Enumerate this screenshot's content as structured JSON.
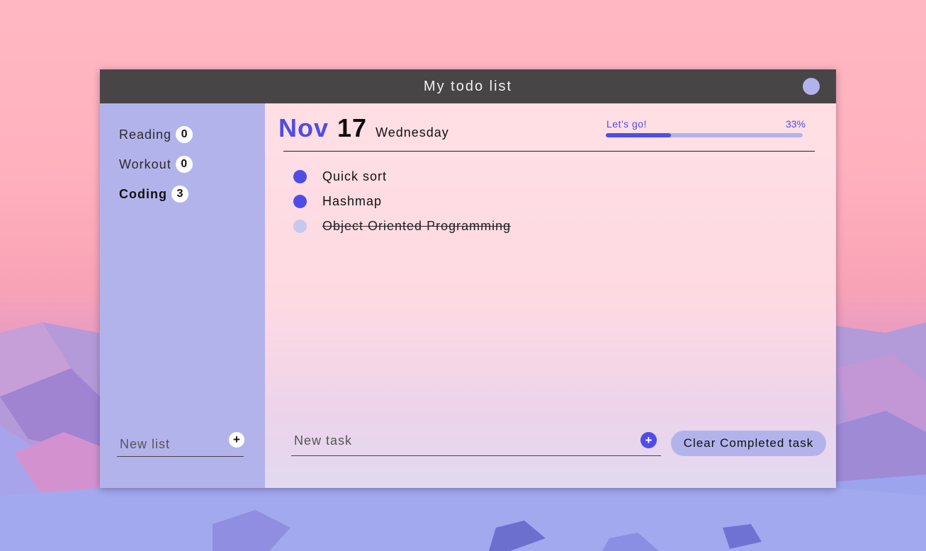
{
  "window": {
    "title": "My todo list"
  },
  "lists": [
    {
      "name": "Reading",
      "count": "0",
      "active": false
    },
    {
      "name": "Workout",
      "count": "0",
      "active": false
    },
    {
      "name": "Coding",
      "count": "3",
      "active": true
    }
  ],
  "new_list": {
    "placeholder": "New list",
    "add_label": "+"
  },
  "date": {
    "month": "Nov",
    "day": "17",
    "weekday": "Wednesday"
  },
  "progress": {
    "label": "Let's go!",
    "percent_text": "33%",
    "value": 0.33
  },
  "tasks": [
    {
      "text": "Quick sort",
      "completed": false
    },
    {
      "text": "Hashmap",
      "completed": false
    },
    {
      "text": "Object Oriented Programming",
      "completed": true
    }
  ],
  "new_task": {
    "placeholder": "New task",
    "add_label": "+"
  },
  "actions": {
    "clear_completed_label": "Clear Completed task"
  },
  "colors": {
    "accent": "#4e4de6",
    "sidebar": "#b3b3ec",
    "titlebar": "#484547"
  }
}
